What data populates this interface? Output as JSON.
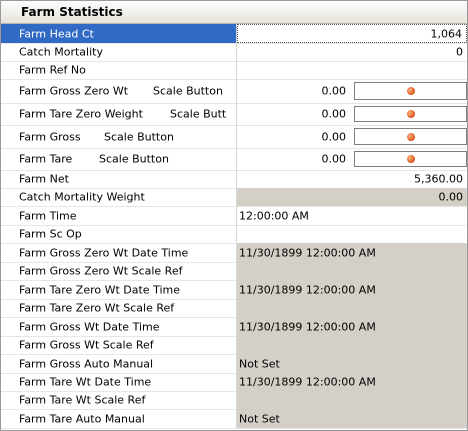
{
  "panel": {
    "title": "Farm Statistics"
  },
  "rows": [
    {
      "label": "Farm Head Ct",
      "value": "1,064"
    },
    {
      "label": "Catch Mortality",
      "value": "0"
    },
    {
      "label": "Farm Ref No",
      "value": ""
    },
    {
      "label": "Farm Gross Zero Wt",
      "scale_label": "Scale Button",
      "value": "0.00"
    },
    {
      "label": "Farm Tare Zero Weight",
      "scale_label": "Scale Butt",
      "value": "0.00"
    },
    {
      "label": "Farm Gross",
      "scale_label": "Scale Button",
      "value": "0.00"
    },
    {
      "label": "Farm Tare",
      "scale_label": "Scale Button",
      "value": "0.00"
    },
    {
      "label": "Farm Net",
      "value": "5,360.00"
    },
    {
      "label": "Catch Mortality Weight",
      "value": "0.00"
    },
    {
      "label": "Farm Time",
      "value": "12:00:00 AM"
    },
    {
      "label": "Farm Sc Op",
      "value": ""
    },
    {
      "label": "Farm Gross Zero Wt Date Time",
      "value": "11/30/1899 12:00:00 AM"
    },
    {
      "label": "Farm Gross Zero Wt Scale Ref",
      "value": ""
    },
    {
      "label": "Farm Tare Zero Wt Date Time",
      "value": "11/30/1899 12:00:00 AM"
    },
    {
      "label": "Farm Tare Zero Wt Scale Ref",
      "value": ""
    },
    {
      "label": "Farm Gross Wt Date Time",
      "value": "11/30/1899 12:00:00 AM"
    },
    {
      "label": "Farm Gross Wt Scale Ref",
      "value": ""
    },
    {
      "label": "Farm Gross Auto Manual",
      "value": "Not Set"
    },
    {
      "label": "Farm Tare Wt Date Time",
      "value": "11/30/1899 12:00:00 AM"
    },
    {
      "label": "Farm Tare Wt Scale Ref",
      "value": ""
    },
    {
      "label": "Farm Tare Auto Manual",
      "value": "Not Set"
    }
  ]
}
